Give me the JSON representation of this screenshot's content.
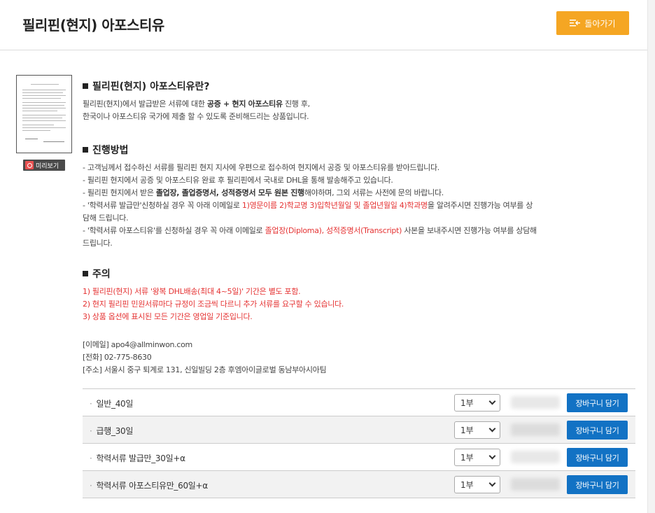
{
  "header": {
    "title": "필리핀(현지) 아포스티유",
    "back_label": "돌아가기",
    "back_color": "#f5a623"
  },
  "preview": {
    "label": "미리보기",
    "icon": "preview-icon"
  },
  "sections": {
    "intro": {
      "title": "필리핀(현지) 아포스티유란?",
      "line1_a": "필리핀(현지)에서 발급받은 서류에 대한 ",
      "line1_b": "공증 + 현지 아포스티유",
      "line1_c": " 진행 후,",
      "line2": "한국이나 아포스티유 국가에 제출 할 수 있도록 준비해드리는 상품입니다."
    },
    "process": {
      "title": "진행방법",
      "l1": "- 고객님께서 접수하신 서류를 필리핀 현지 지사에 우편으로 접수하여 현지에서 공증 및 아포스티유를 받아드립니다.",
      "l2": "- 필리핀 현지에서 공증 및 아포스티유 완료 후 필리핀에서 국내로 DHL을 통해 발송해주고 있습니다.",
      "l3_a": "- 필리핀 현지에서 받은 ",
      "l3_b": "졸업장, 졸업증명서, 성적증명서 모두 원본 진행",
      "l3_c": "해야하며, 그외 서류는 사전에 문의 바랍니다.",
      "l4_a": "- '학력서류 발급만'신청하실 경우 꼭 아래 이메일로 ",
      "l4_b": "1)영문이름 2)학교명 3)입학년월일 및 졸업년월일 4)학과명",
      "l4_c": "을 알려주시면 진행가능 여부를 상",
      "l4_d": "담해 드립니다.",
      "l5_a": "- '학력서류 아포스티유'를 신청하실 경우 꼭 아래 이메일로 ",
      "l5_b": "졸업장(Diploma), 성적증명서(Transcript)",
      "l5_c": " 사본을 보내주시면 진행가능 여부를 상담해",
      "l5_d": "드립니다."
    },
    "notice": {
      "title": "주의",
      "l1": "1) 필리핀(현지) 서류 '왕복 DHL배송(최대 4~5일)' 기간은 별도 포함.",
      "l2": "2) 현지 필리핀 민원서류마다 규정이 조금씩 다르니 추가 서류를 요구할 수 있습니다.",
      "l3": "3) 상품 옵션에 표시된 모든 기간은 영업일 기준입니다."
    },
    "contact": {
      "email": "[이메일] apo4@allminwon.com",
      "phone": "[전화] 02-775-8630",
      "address": "[주소] 서울시 중구 퇴계로 131, 신일빌딩 2층 후엠아이글로벌 동남부아시아팀"
    }
  },
  "options": [
    {
      "name": "일반_40일",
      "qty": "1부",
      "cart": "장바구니 담기"
    },
    {
      "name": "급행_30일",
      "qty": "1부",
      "cart": "장바구니 담기"
    },
    {
      "name": "학력서류 발급만_30일+α",
      "qty": "1부",
      "cart": "장바구니 담기"
    },
    {
      "name": "학력서류 아포스티유만_60일+α",
      "qty": "1부",
      "cart": "장바구니 담기"
    }
  ],
  "colors": {
    "accent_red": "#e53333",
    "cart_blue": "#1272c4"
  }
}
